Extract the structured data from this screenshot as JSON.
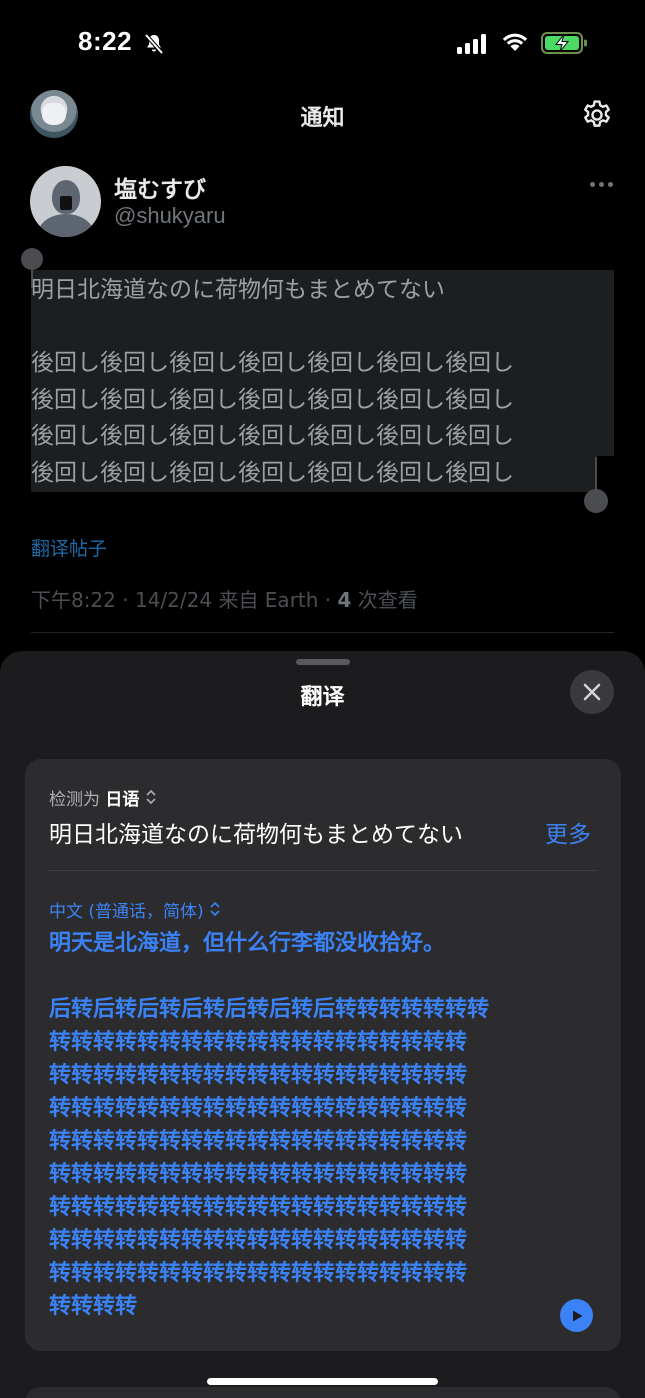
{
  "status_bar": {
    "time": "8:22",
    "icons": [
      "bell-slash-icon",
      "cellular-signal-icon",
      "wifi-icon",
      "battery-charging-icon"
    ]
  },
  "header": {
    "title": "通知",
    "left_icon": "profile-avatar",
    "right_icon": "gear-icon"
  },
  "tweet": {
    "display_name": "塩むすび",
    "handle": "@shukyaru",
    "lines": [
      "明日北海道なのに荷物何もまとめてない",
      "",
      "後回し後回し後回し後回し後回し後回し後回し",
      "後回し後回し後回し後回し後回し後回し後回し",
      "後回し後回し後回し後回し後回し後回し後回し",
      "後回し後回し後回し後回し後回し後回し後回し"
    ],
    "translate_link": "翻译帖子",
    "meta_prefix": "下午8:22 · 14/2/24 来自 Earth · ",
    "views_count": "4",
    "views_label": " 次查看"
  },
  "sheet": {
    "title": "翻译",
    "close_icon": "close-icon",
    "detected_prefix": "检测为",
    "detected_language": "日语",
    "source_text": "明日北海道なのに荷物何もまとめてない",
    "more_label": "更多",
    "target_language": "中文 (普通话，简体)",
    "translated_lines": [
      "明天是北海道，但什么行李都没收拾好。",
      "",
      "后转后转后转后转后转后转后转转转转转转转",
      "转转转转转转转转转转转转转转转转转转转",
      "转转转转转转转转转转转转转转转转转转转",
      "转转转转转转转转转转转转转转转转转转转",
      "转转转转转转转转转转转转转转转转转转转",
      "转转转转转转转转转转转转转转转转转转转",
      "转转转转转转转转转转转转转转转转转转转",
      "转转转转转转转转转转转转转转转转转转转",
      "转转转转转转转转转转转转转转转转转转转",
      "转转转转"
    ],
    "play_icon": "play-icon"
  },
  "colors": {
    "background": "#000000",
    "sheet": "#1c1c1e",
    "card": "#2c2c2e",
    "accent_blue": "#3b82f6",
    "link_blue": "#1d6aa7",
    "secondary_text": "#71767b"
  }
}
